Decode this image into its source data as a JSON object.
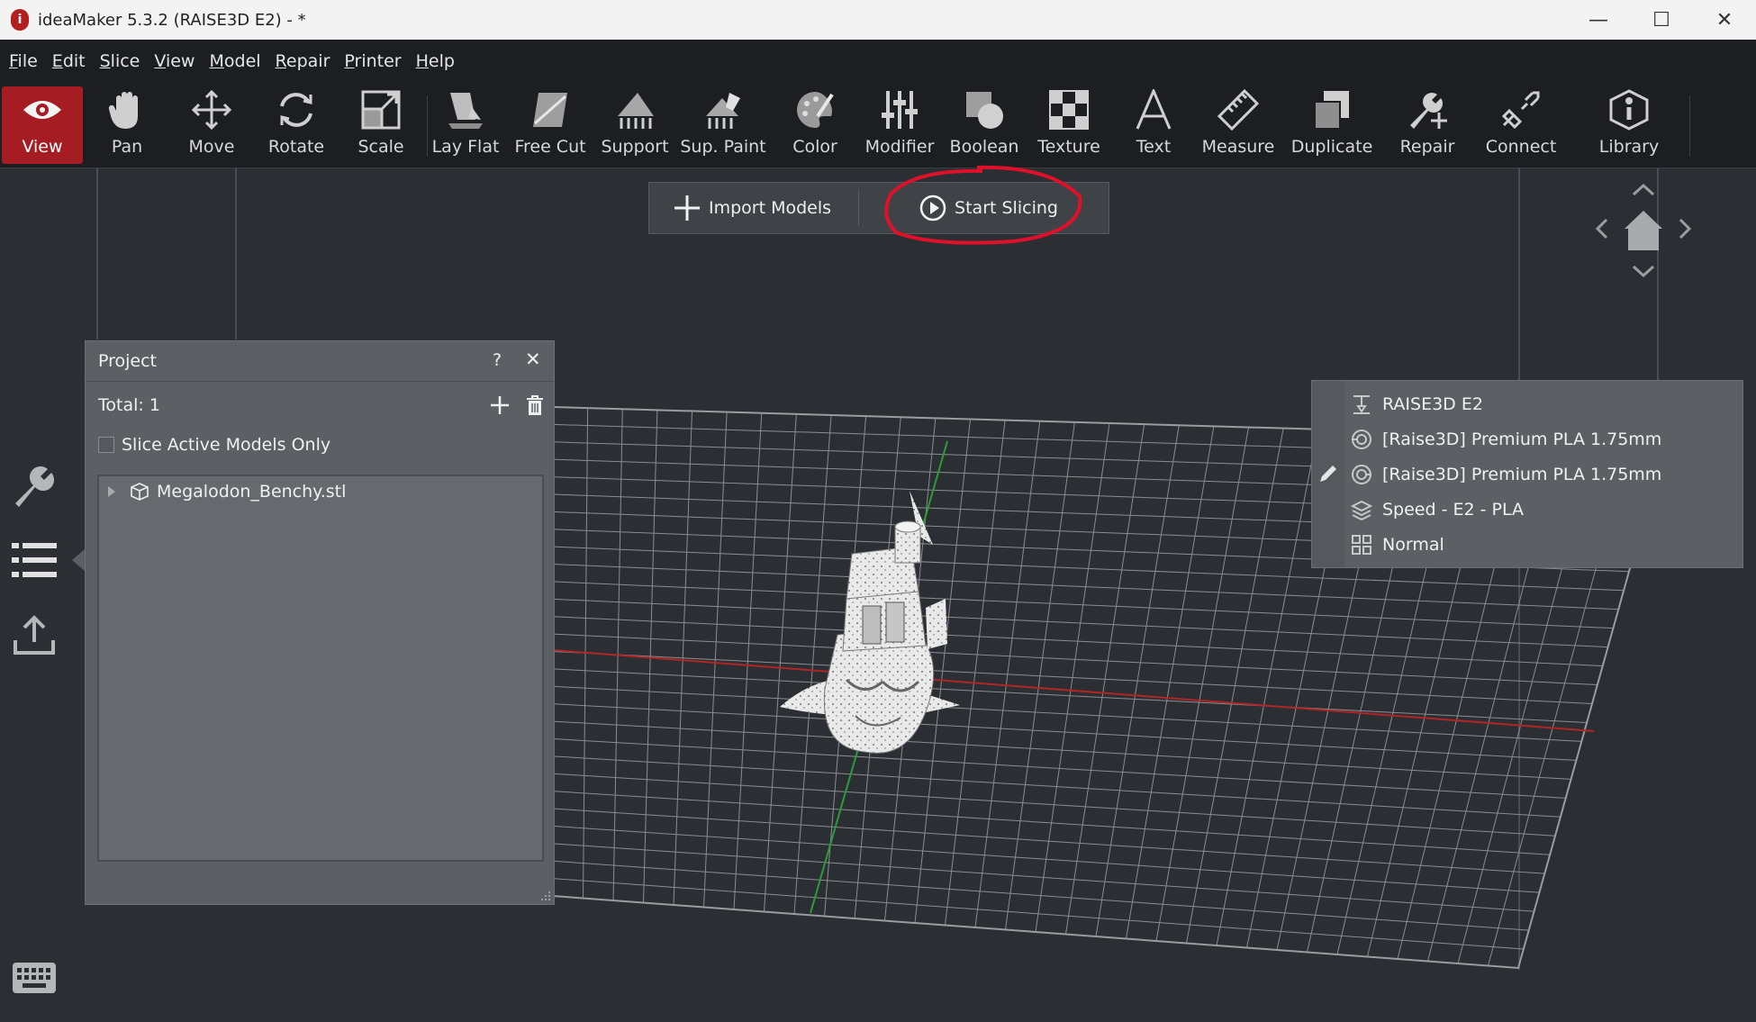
{
  "window": {
    "title": "ideaMaker 5.3.2 (RAISE3D E2) - *",
    "app_icon_glyph": "i",
    "minimize_glyph": "—",
    "maximize_glyph": "☐",
    "close_glyph": "✕"
  },
  "menu": [
    "File",
    "Edit",
    "Slice",
    "View",
    "Model",
    "Repair",
    "Printer",
    "Help"
  ],
  "toolbar": {
    "active": "View",
    "tools": [
      {
        "label": "View",
        "icon": "eye-icon"
      },
      {
        "label": "Pan",
        "icon": "hand-icon"
      },
      {
        "label": "Move",
        "icon": "move-arrows-icon"
      },
      {
        "label": "Rotate",
        "icon": "rotate-icon"
      },
      {
        "label": "Scale",
        "icon": "scale-icon"
      },
      {
        "label": "Lay Flat",
        "icon": "lay-flat-icon"
      },
      {
        "label": "Free Cut",
        "icon": "free-cut-icon"
      },
      {
        "label": "Support",
        "icon": "support-icon"
      },
      {
        "label": "Sup. Paint",
        "icon": "support-paint-icon"
      },
      {
        "label": "Color",
        "icon": "palette-icon"
      },
      {
        "label": "Modifier",
        "icon": "modifier-sliders-icon"
      },
      {
        "label": "Boolean",
        "icon": "boolean-icon"
      },
      {
        "label": "Texture",
        "icon": "texture-checker-icon"
      },
      {
        "label": "Text",
        "icon": "text-a-icon"
      },
      {
        "label": "Measure",
        "icon": "ruler-icon"
      },
      {
        "label": "Duplicate",
        "icon": "duplicate-icon"
      },
      {
        "label": "Repair",
        "icon": "wrench-plus-icon"
      },
      {
        "label": "Connect",
        "icon": "connect-icon"
      },
      {
        "label": "Library",
        "icon": "info-library-icon"
      }
    ]
  },
  "actions": {
    "import_label": "Import Models",
    "start_label": "Start Slicing"
  },
  "project": {
    "title": "Project",
    "help_glyph": "?",
    "close_glyph": "✕",
    "total_label": "Total: 1",
    "slice_active_label": "Slice Active Models Only",
    "slice_active_checked": false,
    "models": [
      {
        "name": "Megalodon_Benchy.stl"
      }
    ]
  },
  "profile": {
    "printer": "RAISE3D E2",
    "filament_left": "[Raise3D] Premium PLA 1.75mm",
    "filament_right": "[Raise3D] Premium PLA 1.75mm",
    "print_profile": "Speed - E2 - PLA",
    "quality": "Normal"
  },
  "colors": {
    "accent_red": "#a51c22",
    "annotation_red": "#e0102a",
    "x_axis": "#b02525",
    "y_axis": "#2f9a3a",
    "grid": "#8a8d90"
  }
}
